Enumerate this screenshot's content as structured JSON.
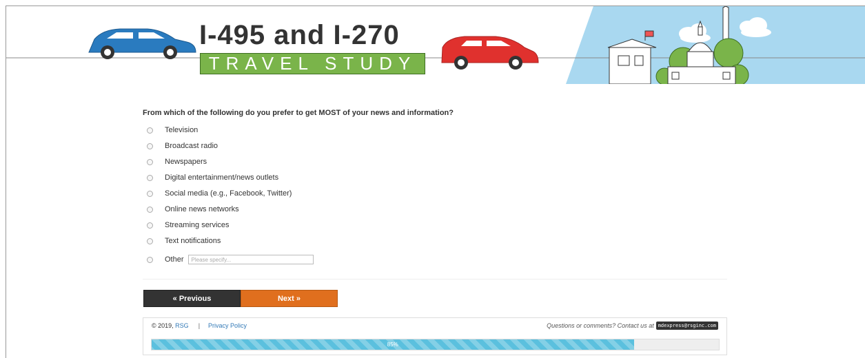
{
  "header": {
    "title": "I-495 and I-270",
    "subtitle": "TRAVEL STUDY"
  },
  "survey": {
    "question": "From which of the following do you prefer to get MOST of your news and information?",
    "options": [
      "Television",
      "Broadcast radio",
      "Newspapers",
      "Digital entertainment/news outlets",
      "Social media (e.g., Facebook, Twitter)",
      "Online news networks",
      "Streaming services",
      "Text notifications",
      "Other"
    ],
    "other_placeholder": "Please specify..."
  },
  "nav": {
    "previous": "« Previous",
    "next": "Next »"
  },
  "footer": {
    "copyright": "© 2019,",
    "company": "RSG",
    "privacy": "Privacy Policy",
    "contact": "Questions or comments? Contact us at",
    "email": "mdexpress@rsginc.com"
  },
  "progress": {
    "value": 0.85,
    "label": "85%"
  },
  "colors": {
    "brand_green": "#7ab44a",
    "next_orange": "#e06f1e",
    "prev_dark": "#333333",
    "progress_blue": "#5bc0de",
    "sky_blue": "#a9d8f0"
  }
}
